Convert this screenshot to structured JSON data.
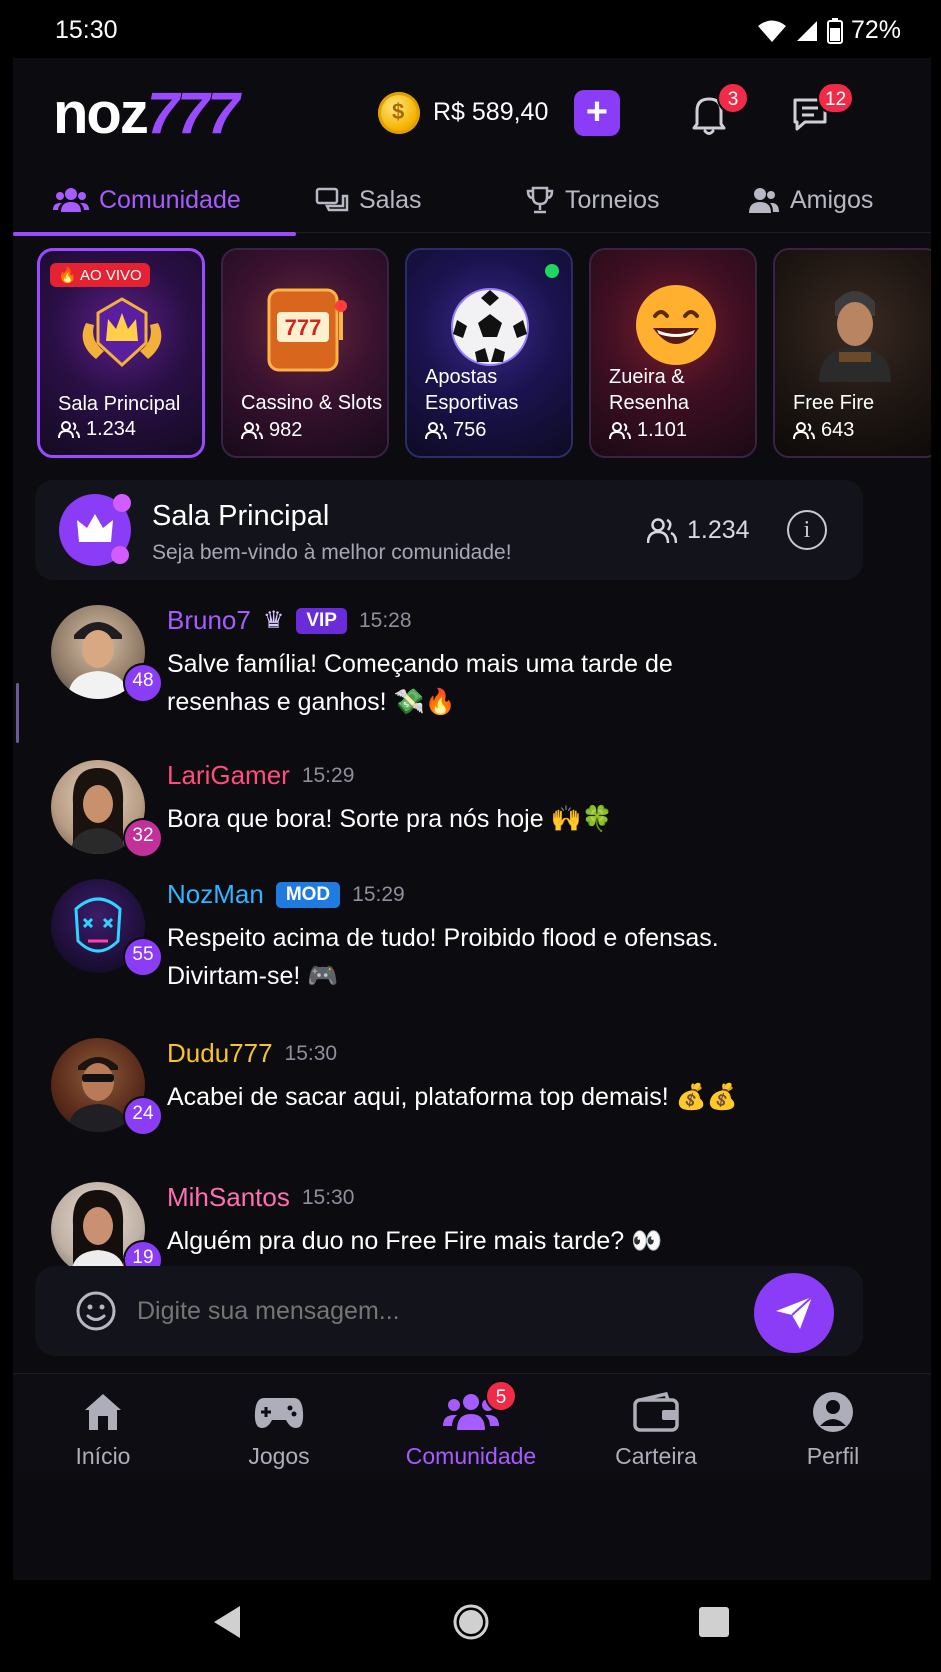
{
  "status_bar": {
    "time": "15:30",
    "battery": "72%"
  },
  "header": {
    "logo_main": "noz",
    "logo_accent": "777",
    "balance": "R$ 589,40",
    "add_label": "+",
    "notifications_count": "3",
    "messages_count": "12"
  },
  "tabs": [
    {
      "label": "Comunidade",
      "icon": "users-icon"
    },
    {
      "label": "Salas",
      "icon": "chat-bubbles-icon"
    },
    {
      "label": "Torneios",
      "icon": "trophy-icon"
    },
    {
      "label": "Amigos",
      "icon": "user-friends-icon"
    }
  ],
  "rooms": [
    {
      "name": "Sala Principal",
      "count": "1.234",
      "badge": "🔥 AO VIVO",
      "icon": "crown-emblem"
    },
    {
      "name": "Cassino & Slots",
      "count": "982",
      "icon": "slot-machine"
    },
    {
      "name": "Apostas Esportivas",
      "count": "756",
      "icon": "soccer-ball",
      "online": true
    },
    {
      "name": "Zueira & Resenha",
      "count": "1.101",
      "icon": "laughing-emoji"
    },
    {
      "name": "Free Fire",
      "count": "643",
      "icon": "soldier-character"
    }
  ],
  "room_info": {
    "title": "Sala Principal",
    "subtitle": "Seja bem-vindo à melhor comunidade!",
    "count": "1.234",
    "info_label": "i"
  },
  "messages": [
    {
      "user": "Bruno7",
      "level": "48",
      "time": "15:28",
      "tag": "VIP",
      "crown": "♛",
      "text": "Salve família! Começando mais uma tarde de resenhas e ganhos! 💸🔥",
      "color": "#a65cff"
    },
    {
      "user": "LariGamer",
      "level": "32",
      "time": "15:29",
      "text": "Bora que bora! Sorte pra nós hoje 🙌🍀",
      "color": "#ff4d7e"
    },
    {
      "user": "NozMan",
      "level": "55",
      "time": "15:29",
      "tag": "MOD",
      "text": "Respeito acima de tudo! Proibido flood e ofensas. Divirtam-se! 🎮",
      "color": "#35b3ff"
    },
    {
      "user": "Dudu777",
      "level": "24",
      "time": "15:30",
      "text": "Acabei de sacar aqui, plataforma top demais! 💰💰",
      "color": "#f7c32a"
    },
    {
      "user": "MihSantos",
      "level": "19",
      "time": "15:30",
      "text": "Alguém pra duo no Free Fire mais tarde? 👀",
      "color": "#ff6fb1"
    }
  ],
  "composer": {
    "placeholder": "Digite sua mensagem..."
  },
  "bottom_nav": [
    {
      "label": "Início",
      "icon": "home-icon"
    },
    {
      "label": "Jogos",
      "icon": "gamepad-icon"
    },
    {
      "label": "Comunidade",
      "icon": "community-icon",
      "badge": "5",
      "active": true
    },
    {
      "label": "Carteira",
      "icon": "wallet-icon"
    },
    {
      "label": "Perfil",
      "icon": "profile-icon"
    }
  ],
  "colors": {
    "accent": "#8b3cf6",
    "background": "#0b0b10",
    "vip": "#6a2bd9",
    "mod": "#1f7be0"
  }
}
